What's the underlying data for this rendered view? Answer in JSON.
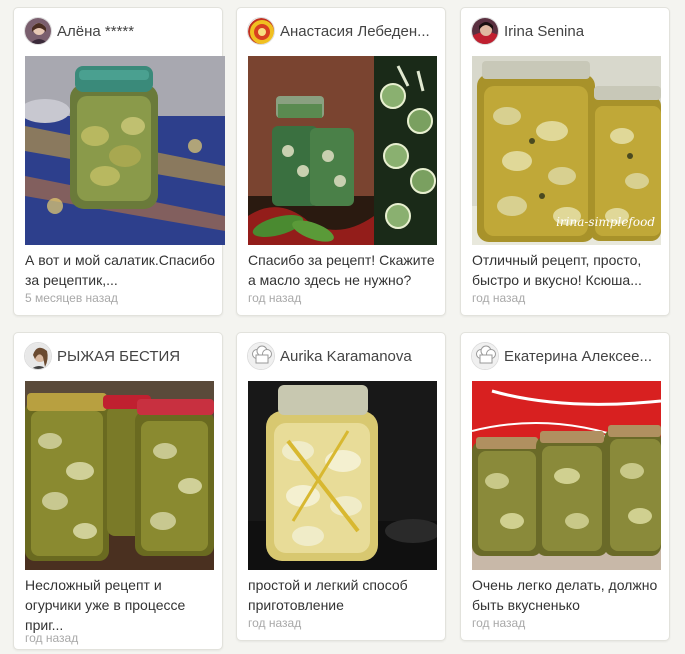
{
  "cards": [
    {
      "author": "Алёна *****",
      "avatar_icon": "user-photo-avatar",
      "comment": "А вот и мой салатик.Спасибо за рецептик,...",
      "time": "5 месяцев назад"
    },
    {
      "author": "Анастасия Лебеден...",
      "avatar_icon": "emblem-avatar",
      "comment": "Спасибо за рецепт! Скажите а масло здесь не нужно?",
      "time": "год назад"
    },
    {
      "author": "Irina Senina",
      "avatar_icon": "user-photo-avatar",
      "comment": "Отличный рецепт, просто, быстро и вкусно! Ксюша...",
      "time": "год назад",
      "watermark": "irina-simplefood"
    },
    {
      "author": "РЫЖАЯ БЕСТИЯ",
      "avatar_icon": "user-photo-avatar",
      "comment": "Несложный рецепт и огурчики уже в процессе приг...",
      "time": "год назад"
    },
    {
      "author": "Aurika Karamanova",
      "avatar_icon": "chef-hat-icon",
      "comment": "простой и легкий способ приготовление",
      "time": "год назад"
    },
    {
      "author": "Екатерина Алексее...",
      "avatar_icon": "chef-hat-icon",
      "comment": "Очень легко делать, должно быть вкусненько",
      "time": "год назад"
    }
  ]
}
